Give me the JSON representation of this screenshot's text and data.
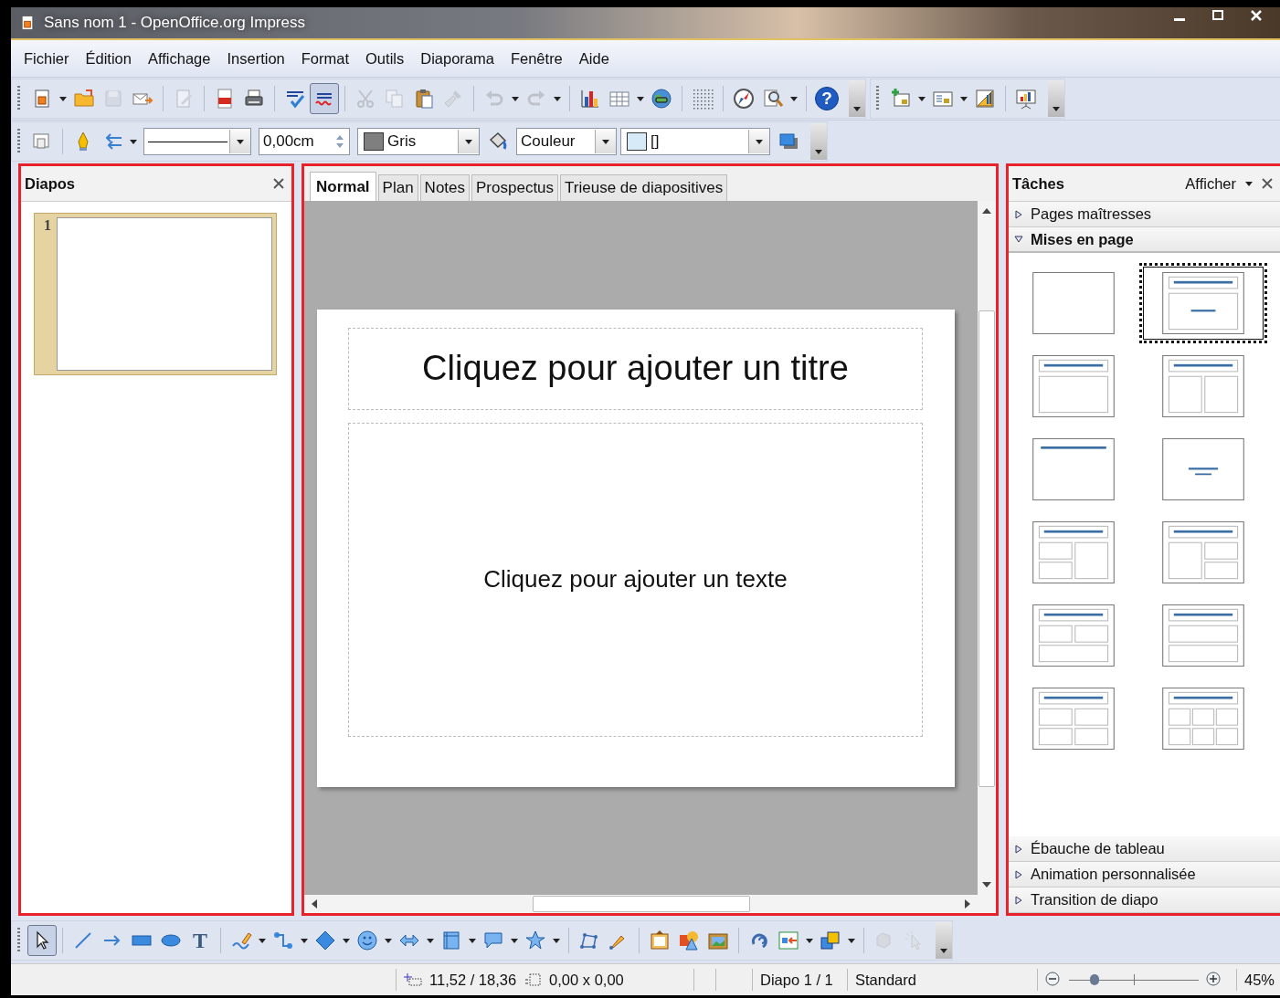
{
  "window": {
    "title": "Sans nom 1 - OpenOffice.org Impress"
  },
  "menu": [
    "Fichier",
    "Édition",
    "Affichage",
    "Insertion",
    "Format",
    "Outils",
    "Diaporama",
    "Fenêtre",
    "Aide"
  ],
  "standard_toolbar": [
    {
      "items": [
        {
          "kind": "new",
          "menu": true,
          "disabled": false,
          "pressed": false
        },
        {
          "kind": "open",
          "menu": false,
          "disabled": false,
          "pressed": false
        },
        {
          "kind": "save",
          "menu": false,
          "disabled": true,
          "pressed": false
        },
        {
          "kind": "email",
          "menu": false,
          "disabled": false,
          "pressed": false
        }
      ]
    },
    {
      "items": [
        {
          "kind": "edit",
          "menu": false,
          "disabled": true,
          "pressed": false
        }
      ]
    },
    {
      "items": [
        {
          "kind": "pdf",
          "menu": false,
          "disabled": false,
          "pressed": false
        },
        {
          "kind": "print",
          "menu": false,
          "disabled": false,
          "pressed": false
        }
      ]
    },
    {
      "items": [
        {
          "kind": "spell",
          "menu": false,
          "disabled": false,
          "pressed": false
        },
        {
          "kind": "autospell",
          "menu": false,
          "disabled": false,
          "pressed": true
        }
      ]
    },
    {
      "items": [
        {
          "kind": "cut",
          "menu": false,
          "disabled": true,
          "pressed": false
        },
        {
          "kind": "copy",
          "menu": false,
          "disabled": true,
          "pressed": false
        },
        {
          "kind": "paste",
          "menu": false,
          "disabled": false,
          "pressed": false
        },
        {
          "kind": "brush",
          "menu": false,
          "disabled": true,
          "pressed": false
        }
      ]
    },
    {
      "items": [
        {
          "kind": "undo",
          "menu": true,
          "disabled": true,
          "pressed": false
        },
        {
          "kind": "redo",
          "menu": true,
          "disabled": true,
          "pressed": false
        }
      ]
    },
    {
      "items": [
        {
          "kind": "chart",
          "menu": false,
          "disabled": false,
          "pressed": false
        },
        {
          "kind": "table",
          "menu": true,
          "disabled": false,
          "pressed": false
        },
        {
          "kind": "globe",
          "menu": false,
          "disabled": false,
          "pressed": false
        }
      ]
    },
    {
      "items": [
        {
          "kind": "grid",
          "menu": false,
          "disabled": false,
          "pressed": false
        }
      ]
    },
    {
      "items": [
        {
          "kind": "navigator",
          "menu": false,
          "disabled": false,
          "pressed": false
        },
        {
          "kind": "zoom",
          "menu": true,
          "disabled": false,
          "pressed": false
        }
      ]
    },
    {
      "items": [
        {
          "kind": "help",
          "glyph": "?",
          "menu": false,
          "disabled": false,
          "pressed": false
        }
      ]
    }
  ],
  "presentation_toolbar": [
    {
      "items": [
        {
          "kind": "new-slide",
          "menu": true,
          "disabled": false,
          "pressed": false
        },
        {
          "kind": "layout",
          "menu": true,
          "disabled": false,
          "pressed": false
        },
        {
          "kind": "design",
          "menu": false,
          "disabled": false,
          "pressed": false
        }
      ]
    },
    {
      "items": [
        {
          "kind": "slideshow",
          "menu": false,
          "disabled": false,
          "pressed": false
        }
      ]
    }
  ],
  "line_fill_toolbar": [
    {
      "items": [
        {
          "kind": "slide-props",
          "menu": false
        }
      ]
    },
    {
      "items": [
        {
          "kind": "pen",
          "menu": false
        },
        {
          "kind": "arrow-style",
          "menu": true
        },
        {
          "kind": "line-style"
        },
        {
          "kind": "width",
          "value": "0,00cm"
        },
        {
          "kind": "color",
          "value": "Gris",
          "color": "#7f7f7f"
        },
        {
          "kind": "bucket",
          "menu": false
        },
        {
          "kind": "area-style",
          "value": "Couleur"
        },
        {
          "kind": "fill",
          "value": "[]",
          "color": "#d6eaf8"
        },
        {
          "kind": "shadow",
          "menu": false
        }
      ]
    }
  ],
  "slides_pane": {
    "title": "Diapos",
    "slides": [
      {
        "number": "1",
        "selected": true
      }
    ]
  },
  "view_tabs": [
    {
      "label": "Normal",
      "selected": true
    },
    {
      "label": "Plan",
      "selected": false
    },
    {
      "label": "Notes",
      "selected": false
    },
    {
      "label": "Prospectus",
      "selected": false
    },
    {
      "label": "Trieuse de diapositives",
      "selected": false
    }
  ],
  "slide": {
    "title_placeholder": "Cliquez pour ajouter un titre",
    "body_placeholder": "Cliquez pour ajouter un texte"
  },
  "task_pane": {
    "title": "Tâches",
    "view_menu": "Afficher",
    "sections": [
      {
        "label": "Pages maîtresses",
        "expanded": false
      },
      {
        "label": "Mises en page",
        "expanded": true,
        "layouts": [
          {
            "kind": "blank",
            "selected": false
          },
          {
            "kind": "title-subtitle",
            "selected": true
          },
          {
            "kind": "title-content",
            "selected": false
          },
          {
            "kind": "title-2col",
            "selected": false
          },
          {
            "kind": "title-only",
            "selected": false
          },
          {
            "kind": "centered",
            "selected": false
          },
          {
            "kind": "left2-right1",
            "selected": false
          },
          {
            "kind": "left1-right2",
            "selected": false
          },
          {
            "kind": "top2-bottom1",
            "selected": false
          },
          {
            "kind": "title-2rows",
            "selected": false
          },
          {
            "kind": "grid4",
            "selected": false
          },
          {
            "kind": "grid6",
            "selected": false
          }
        ]
      },
      {
        "label": "Ébauche de tableau",
        "expanded": false
      },
      {
        "label": "Animation personnalisée",
        "expanded": false
      },
      {
        "label": "Transition de diapo",
        "expanded": false
      }
    ]
  },
  "drawing_toolbar": [
    {
      "items": [
        {
          "kind": "select",
          "menu": false,
          "disabled": false,
          "pressed": true
        }
      ]
    },
    {
      "items": [
        {
          "kind": "line",
          "menu": false,
          "disabled": false,
          "pressed": false
        },
        {
          "kind": "arrow",
          "menu": false,
          "disabled": false,
          "pressed": false
        },
        {
          "kind": "rect",
          "menu": false,
          "disabled": false,
          "pressed": false
        },
        {
          "kind": "ellipse",
          "menu": false,
          "disabled": false,
          "pressed": false
        },
        {
          "kind": "text",
          "glyph": "T",
          "menu": false,
          "disabled": false,
          "pressed": false
        }
      ]
    },
    {
      "items": [
        {
          "kind": "curve",
          "menu": true,
          "disabled": false,
          "pressed": false
        },
        {
          "kind": "connector",
          "menu": true,
          "disabled": false,
          "pressed": false
        },
        {
          "kind": "diamond",
          "menu": true,
          "disabled": false,
          "pressed": false
        },
        {
          "kind": "smiley",
          "menu": true,
          "disabled": false,
          "pressed": false
        },
        {
          "kind": "double-arrow",
          "menu": true,
          "disabled": false,
          "pressed": false
        },
        {
          "kind": "flowchart",
          "menu": true,
          "disabled": false,
          "pressed": false
        },
        {
          "kind": "callout",
          "menu": true,
          "disabled": false,
          "pressed": false
        },
        {
          "kind": "star",
          "menu": true,
          "disabled": false,
          "pressed": false
        }
      ]
    },
    {
      "items": [
        {
          "kind": "points",
          "menu": false,
          "disabled": false,
          "pressed": false
        },
        {
          "kind": "glue",
          "menu": false,
          "disabled": false,
          "pressed": false
        }
      ]
    },
    {
      "items": [
        {
          "kind": "frame",
          "menu": false,
          "disabled": false,
          "pressed": false
        },
        {
          "kind": "shapes",
          "menu": false,
          "disabled": false,
          "pressed": false
        },
        {
          "kind": "picture",
          "menu": false,
          "disabled": false,
          "pressed": false
        }
      ]
    },
    {
      "items": [
        {
          "kind": "rotate",
          "menu": false,
          "disabled": false,
          "pressed": false
        },
        {
          "kind": "align",
          "menu": true,
          "disabled": false,
          "pressed": false
        },
        {
          "kind": "arrange",
          "menu": true,
          "disabled": false,
          "pressed": false
        }
      ]
    },
    {
      "items": [
        {
          "kind": "extrusion",
          "menu": false,
          "disabled": true,
          "pressed": false
        },
        {
          "kind": "interaction",
          "menu": false,
          "disabled": true,
          "pressed": false
        }
      ]
    }
  ],
  "status_bar": {
    "position": "11,52 / 18,36",
    "size": "0,00 x 0,00",
    "slide": "Diapo 1 / 1",
    "master": "Standard",
    "zoom": {
      "level": 0.2
    },
    "zoom_percent": "45%"
  }
}
